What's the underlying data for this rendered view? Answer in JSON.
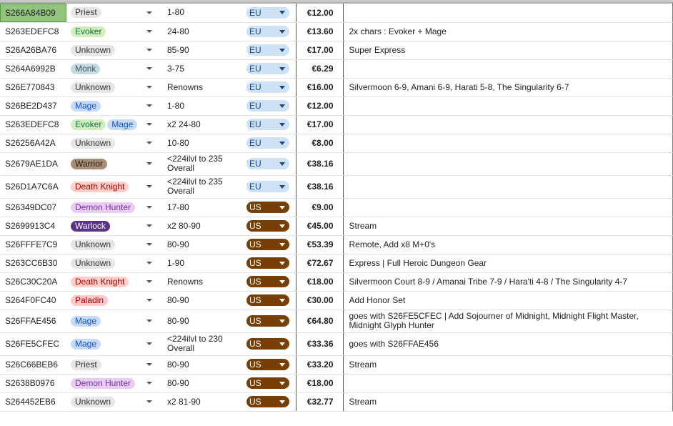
{
  "colors": {
    "selected_cell": "#93c47d",
    "region_eu_bg": "#cfe2f3",
    "region_eu_text": "#1c4587",
    "region_us_bg": "#783f04",
    "region_us_text": "#ffffff"
  },
  "class_styles": {
    "Priest": {
      "bg": "#e6e6e6",
      "fg": "#333333"
    },
    "Evoker": {
      "bg": "#d4edbc",
      "fg": "#11734b"
    },
    "Unknown": {
      "bg": "#e6e6e6",
      "fg": "#333333"
    },
    "Monk": {
      "bg": "#c6dbe1",
      "fg": "#3d5a63"
    },
    "Mage": {
      "bg": "#c9daf8",
      "fg": "#1155cc"
    },
    "Warrior": {
      "bg": "#a58d77",
      "fg": "#2b1d12"
    },
    "Death Knight": {
      "bg": "#ffcfc9",
      "fg": "#b10202"
    },
    "Demon Hunter": {
      "bg": "#e6cff2",
      "fg": "#7b2ea5"
    },
    "Warlock": {
      "bg": "#5a3286",
      "fg": "#ffffff"
    },
    "Paladin": {
      "bg": "#ffc8c8",
      "fg": "#b10202"
    }
  },
  "rows": [
    {
      "id": "S266A84B09",
      "classes": [
        "Priest"
      ],
      "level": "1-80",
      "region": "EU",
      "price": "€12.00",
      "note": ""
    },
    {
      "id": "S263EDEFC8",
      "classes": [
        "Evoker"
      ],
      "level": "24-80",
      "region": "EU",
      "price": "€13.60",
      "note": "2x chars : Evoker + Mage"
    },
    {
      "id": "S26A26BA76",
      "classes": [
        "Unknown"
      ],
      "level": "85-90",
      "region": "EU",
      "price": "€17.00",
      "note": "Super Express"
    },
    {
      "id": "S264A6992B",
      "classes": [
        "Monk"
      ],
      "level": "3-75",
      "region": "EU",
      "price": "€6.29",
      "note": ""
    },
    {
      "id": "S26E770843",
      "classes": [
        "Unknown"
      ],
      "level": "Renowns",
      "region": "EU",
      "price": "€16.00",
      "note": "Silvermoon 6-9, Amani 6-9, Harati 5-8, The Singularity 6-7"
    },
    {
      "id": "S26BE2D437",
      "classes": [
        "Mage"
      ],
      "level": "1-80",
      "region": "EU",
      "price": "€12.00",
      "note": ""
    },
    {
      "id": "S263EDEFC8",
      "classes": [
        "Evoker",
        "Mage"
      ],
      "level": "x2 24-80",
      "region": "EU",
      "price": "€17.00",
      "note": ""
    },
    {
      "id": "S26256A42A",
      "classes": [
        "Unknown"
      ],
      "level": "10-80",
      "region": "EU",
      "price": "€8.00",
      "note": ""
    },
    {
      "id": "S2679AE1DA",
      "classes": [
        "Warrior"
      ],
      "level": "<224ilvl to 235 Overall",
      "region": "EU",
      "price": "€38.16",
      "note": ""
    },
    {
      "id": "S26D1A7C6A",
      "classes": [
        "Death Knight"
      ],
      "level": "<224ilvl to 235 Overall",
      "region": "EU",
      "price": "€38.16",
      "note": ""
    },
    {
      "id": "S26349DC07",
      "classes": [
        "Demon Hunter"
      ],
      "level": "17-80",
      "region": "US",
      "price": "€9.00",
      "note": ""
    },
    {
      "id": "S2699913C4",
      "classes": [
        "Warlock"
      ],
      "level": "x2 80-90",
      "region": "US",
      "price": "€45.00",
      "note": "Stream"
    },
    {
      "id": "S26FFFE7C9",
      "classes": [
        "Unknown"
      ],
      "level": "80-90",
      "region": "US",
      "price": "€53.39",
      "note": "Remote, Add x8 M+0's"
    },
    {
      "id": "S263CC6B30",
      "classes": [
        "Unknown"
      ],
      "level": "1-90",
      "region": "US",
      "price": "€72.67",
      "note": "Express | Full Heroic Dungeon Gear"
    },
    {
      "id": "S26C30C20A",
      "classes": [
        "Death Knight"
      ],
      "level": "Renowns",
      "region": "US",
      "price": "€18.00",
      "note": "Silvermoon Court 8-9 /  Amanai Tribe 7-9 / Hara'ti 4-8 / The Singularity 4-7"
    },
    {
      "id": "S264F0FC40",
      "classes": [
        "Paladin"
      ],
      "level": "80-90",
      "region": "US",
      "price": "€30.00",
      "note": "Add Honor Set"
    },
    {
      "id": "S26FFAE456",
      "classes": [
        "Mage"
      ],
      "level": "80-90",
      "region": "US",
      "price": "€64.80",
      "note": "goes with S26FE5CFEC | Add Sojourner of Midnight, Midnight Flight Master, Midnight Glyph Hunter"
    },
    {
      "id": "S26FE5CFEC",
      "classes": [
        "Mage"
      ],
      "level": "<224ilvl to 230 Overall",
      "region": "US",
      "price": "€33.36",
      "note": "goes with S26FFAE456"
    },
    {
      "id": "S26C66BEB6",
      "classes": [
        "Priest"
      ],
      "level": "80-90",
      "region": "US",
      "price": "€33.20",
      "note": "Stream"
    },
    {
      "id": "S2638B0976",
      "classes": [
        "Demon Hunter"
      ],
      "level": "80-90",
      "region": "US",
      "price": "€18.00",
      "note": ""
    },
    {
      "id": "S264452EB6",
      "classes": [
        "Unknown"
      ],
      "level": "x2 81-90",
      "region": "US",
      "price": "€32.77",
      "note": "Stream"
    }
  ]
}
